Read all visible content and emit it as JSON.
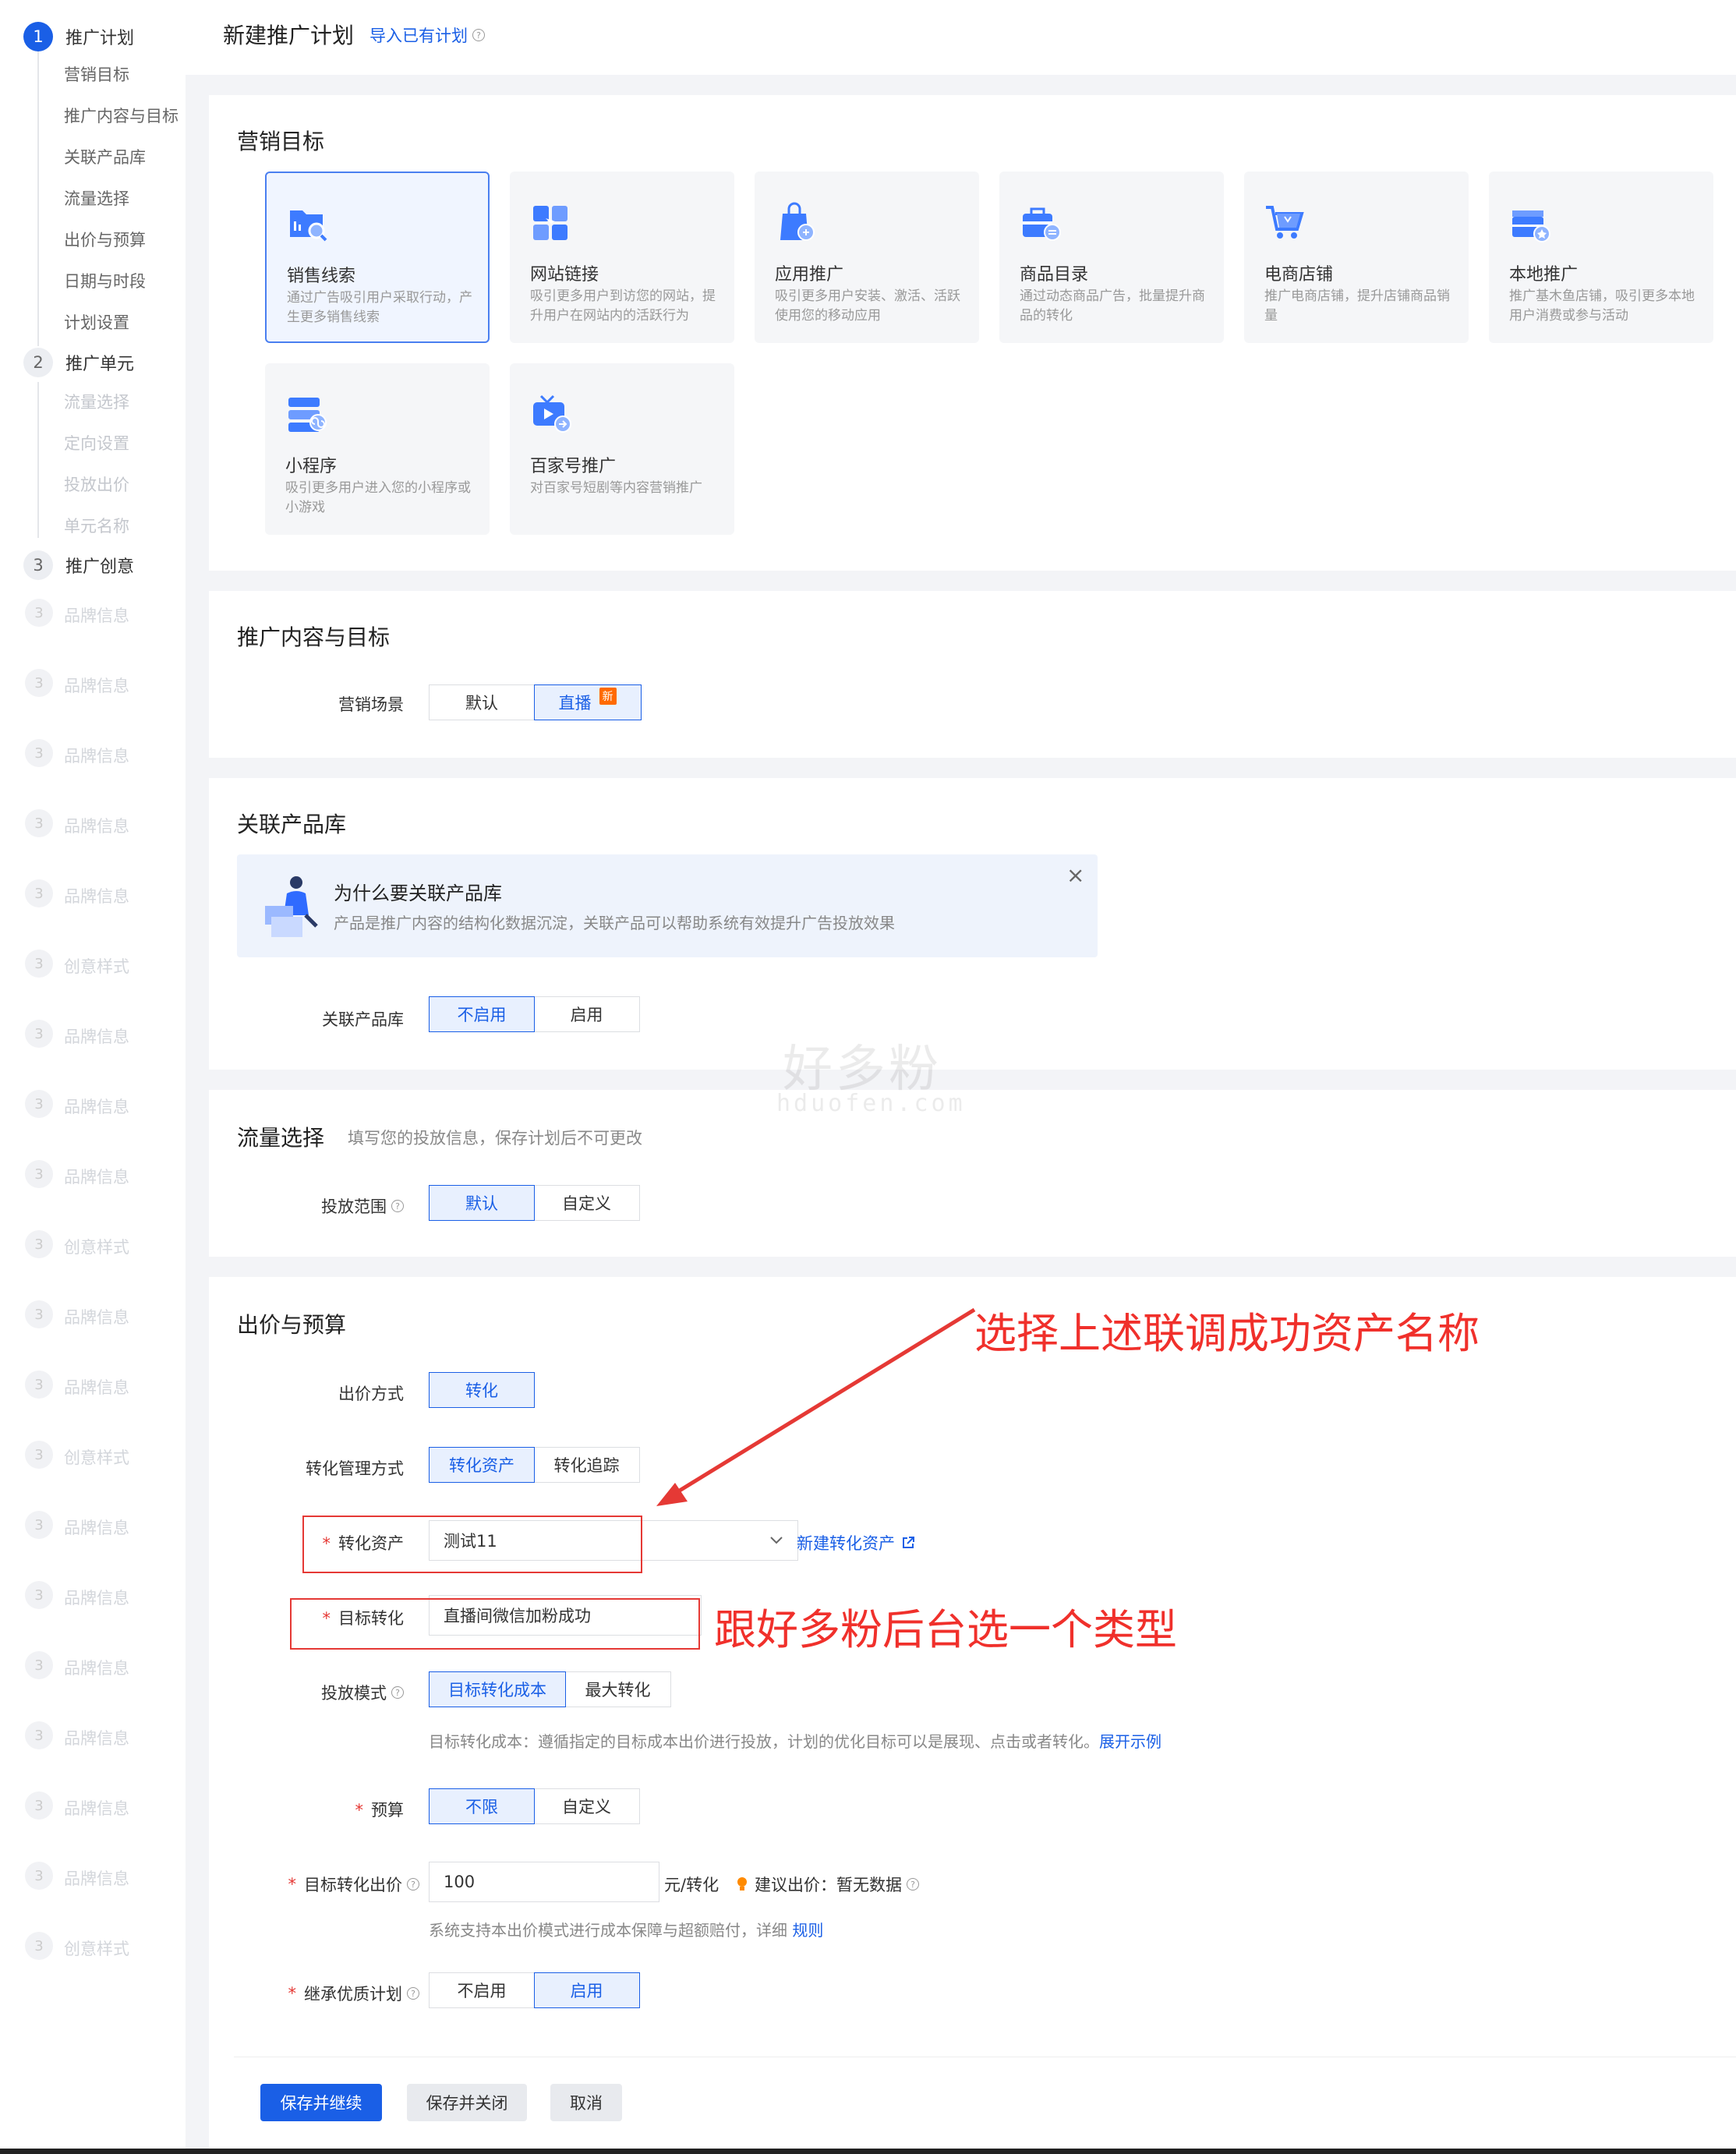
{
  "sidebar": {
    "steps": [
      {
        "num": "1",
        "label": "推广计划",
        "subs": [
          "营销目标",
          "推广内容与目标",
          "关联产品库",
          "流量选择",
          "出价与预算",
          "日期与时段",
          "计划设置"
        ]
      },
      {
        "num": "2",
        "label": "推广单元",
        "subs": [
          "流量选择",
          "定向设置",
          "投放出价",
          "单元名称"
        ]
      },
      {
        "num": "3",
        "label": "推广创意",
        "ghost": [
          "品牌信息",
          "品牌信息",
          "品牌信息",
          "品牌信息",
          "品牌信息",
          "创意样式",
          "品牌信息",
          "品牌信息",
          "品牌信息",
          "创意样式",
          "品牌信息",
          "品牌信息",
          "创意样式",
          "品牌信息",
          "品牌信息",
          "品牌信息",
          "品牌信息",
          "品牌信息",
          "品牌信息",
          "创意样式"
        ]
      }
    ]
  },
  "header": {
    "title": "新建推广计划",
    "import_link": "导入已有计划"
  },
  "marketing_goal": {
    "title": "营销目标",
    "options": [
      {
        "title": "销售线索",
        "desc": "通过广告吸引用户采取行动，产生更多销售线索",
        "icon": "folder-search-icon"
      },
      {
        "title": "网站链接",
        "desc": "吸引更多用户到访您的网站，提升用户在网站内的活跃行为",
        "icon": "grid-link-icon"
      },
      {
        "title": "应用推广",
        "desc": "吸引更多用户安装、激活、活跃使用您的移动应用",
        "icon": "app-bag-icon"
      },
      {
        "title": "商品目录",
        "desc": "通过动态商品广告，批量提升商品的转化",
        "icon": "briefcase-icon"
      },
      {
        "title": "电商店铺",
        "desc": "推广电商店铺，提升店铺商品销量",
        "icon": "shopping-cart-icon"
      },
      {
        "title": "本地推广",
        "desc": "推广基木鱼店铺，吸引更多本地用户消费或参与活动",
        "icon": "local-store-icon"
      },
      {
        "title": "小程序",
        "desc": "吸引更多用户进入您的小程序或小游戏",
        "icon": "mini-program-icon"
      },
      {
        "title": "百家号推广",
        "desc": "对百家号短剧等内容营销推广",
        "icon": "tv-play-icon"
      }
    ]
  },
  "content_goal": {
    "title": "推广内容与目标",
    "scene_label": "营销场景",
    "scene_options": [
      "默认",
      "直播"
    ],
    "new_badge": "新"
  },
  "product_lib": {
    "title": "关联产品库",
    "tip_title": "为什么要关联产品库",
    "tip_desc": "产品是推广内容的结构化数据沉淀，关联产品可以帮助系统有效提升广告投放效果",
    "close": "×",
    "label": "关联产品库",
    "options": [
      "不启用",
      "启用"
    ]
  },
  "traffic": {
    "title": "流量选择",
    "subtitle": "填写您的投放信息，保存计划后不可更改",
    "label": "投放范围",
    "options": [
      "默认",
      "自定义"
    ]
  },
  "bid_budget": {
    "title": "出价与预算",
    "bid_method_label": "出价方式",
    "bid_method_options": [
      "转化"
    ],
    "conv_mgmt_label": "转化管理方式",
    "conv_mgmt_options": [
      "转化资产",
      "转化追踪"
    ],
    "conv_asset_label": "转化资产",
    "conv_asset_value": "测试11",
    "new_asset_link": "新建转化资产",
    "target_conv_label": "目标转化",
    "target_conv_value": "直播间微信加粉成功",
    "delivery_mode_label": "投放模式",
    "delivery_mode_options": [
      "目标转化成本",
      "最大转化"
    ],
    "delivery_mode_hint": "目标转化成本：遵循指定的目标成本出价进行投放，计划的优化目标可以是展现、点击或者转化。",
    "expand_example": "展开示例",
    "budget_label": "预算",
    "budget_options": [
      "不限",
      "自定义"
    ],
    "target_bid_label": "目标转化出价",
    "target_bid_value": "100",
    "target_bid_unit": "元/转化",
    "suggest_bid": "建议出价：暂无数据",
    "bid_hint": "系统支持本出价模式进行成本保障与超额赔付，详细",
    "rules_link": "规则",
    "inherit_label": "继承优质计划",
    "inherit_options": [
      "不启用",
      "启用"
    ]
  },
  "annotations": {
    "arrow_text": "选择上述联调成功资产名称",
    "type_text": "跟好多粉后台选一个类型",
    "watermark_cn": "好多粉",
    "watermark_en": "hduofen.com"
  },
  "footer": {
    "save_continue": "保存并继续",
    "save_close": "保存并关闭",
    "cancel": "取消"
  },
  "colors": {
    "primary": "#1a5fe6",
    "annotation_red": "#e53935"
  }
}
